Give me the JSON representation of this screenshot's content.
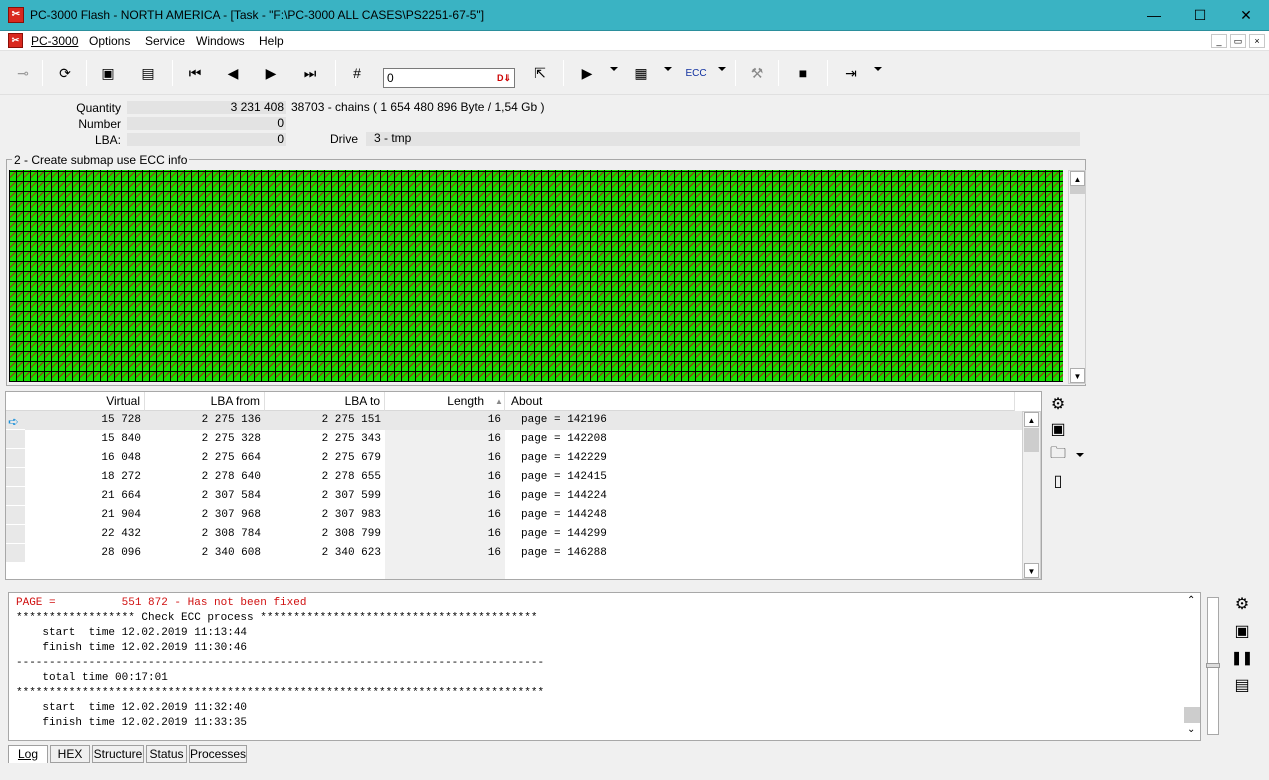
{
  "window": {
    "title": "PC-3000 Flash - NORTH AMERICA - [Task - \"F:\\PC-3000 ALL CASES\\PS2251-67-5\"]",
    "minimize": "—",
    "maximize": "☐",
    "close": "✕"
  },
  "menu": {
    "items": [
      "PC-3000",
      "Options",
      "Service",
      "Windows",
      "Help"
    ],
    "mdi": [
      "_",
      "▭",
      "×"
    ]
  },
  "toolbar": {
    "input_value": "0",
    "input_button": "D⇓",
    "ecc_label": "ECC"
  },
  "info": {
    "quantity_label": "Quantity",
    "quantity_value": "3 231 408",
    "chains": "38703 - chains  ( 1 654 480 896 Byte /  1,54 Gb )",
    "number_label": "Number",
    "number_value": "0",
    "lba_label": "LBA:",
    "lba_value": "0",
    "drive_label": "Drive",
    "drive_value": "3 - tmp"
  },
  "map_panel": {
    "title": "2 - Create submap use ECC info"
  },
  "table": {
    "columns": [
      "Virtual",
      "LBA from",
      "LBA to",
      "Length",
      "About"
    ],
    "rows": [
      [
        "15 728",
        "2 275 136",
        "2 275 151",
        "16",
        "page = 142196"
      ],
      [
        "15 840",
        "2 275 328",
        "2 275 343",
        "16",
        "page = 142208"
      ],
      [
        "16 048",
        "2 275 664",
        "2 275 679",
        "16",
        "page = 142229"
      ],
      [
        "18 272",
        "2 278 640",
        "2 278 655",
        "16",
        "page = 142415"
      ],
      [
        "21 664",
        "2 307 584",
        "2 307 599",
        "16",
        "page = 144224"
      ],
      [
        "21 904",
        "2 307 968",
        "2 307 983",
        "16",
        "page = 144248"
      ],
      [
        "22 432",
        "2 308 784",
        "2 308 799",
        "16",
        "page = 144299"
      ],
      [
        "28 096",
        "2 340 608",
        "2 340 623",
        "16",
        "page = 146288"
      ]
    ]
  },
  "log": {
    "lines": [
      "PAGE =          551 872 - Has not been fixed",
      "****************** Check ECC process ******************************************",
      "    start  time 12.02.2019 11:13:44",
      "    finish time 12.02.2019 11:30:46",
      "--------------------------------------------------------------------------------",
      "    total time 00:17:01",
      "********************************************************************************",
      "    start  time 12.02.2019 11:32:40",
      "    finish time 12.02.2019 11:33:35"
    ],
    "first_line_color": "#d01010"
  },
  "tabs": [
    "Log",
    "HEX",
    "Structure",
    "Status",
    "Processes"
  ],
  "colors": {
    "titlebar": "#3ab3c3",
    "map_good": "#16e000",
    "map_mark": "#a32a18"
  }
}
